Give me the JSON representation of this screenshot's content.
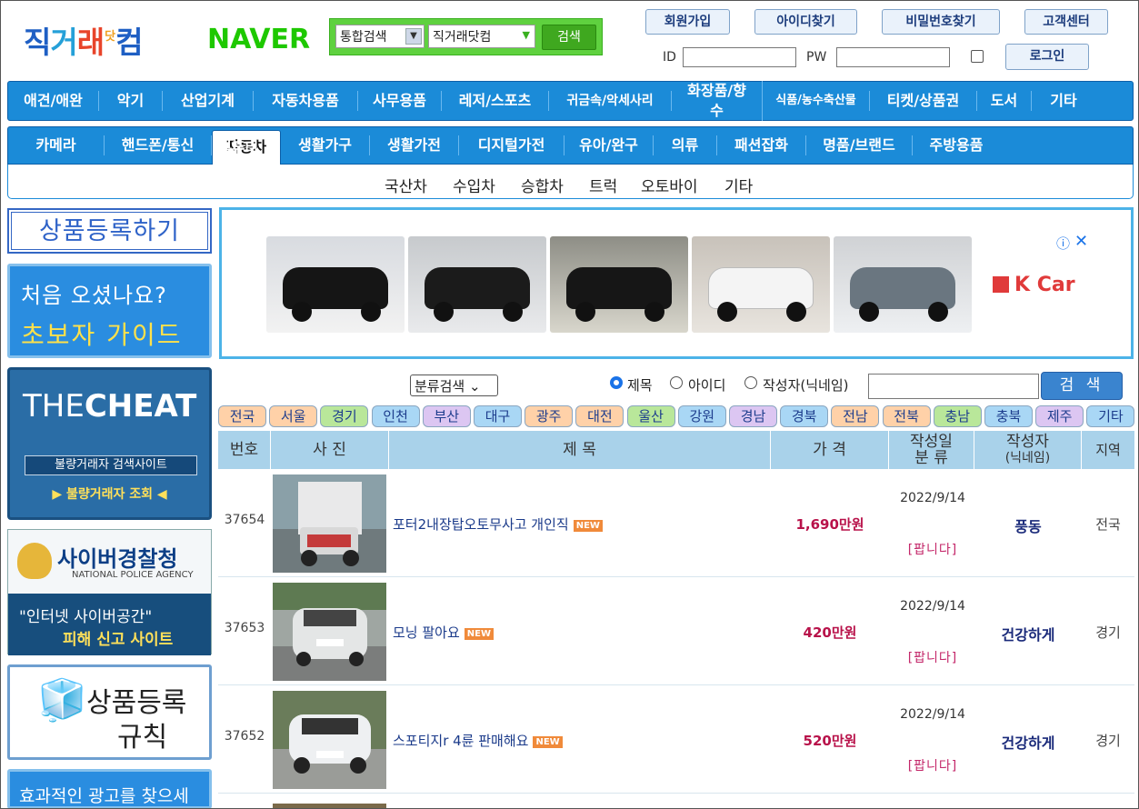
{
  "header": {
    "logo": {
      "part1": "직",
      "part2": "거",
      "part3": "래",
      "sup": "닷",
      "part4": "컴"
    },
    "naver": "NAVER",
    "search": {
      "scope": "통합검색",
      "site": "직거래닷컴",
      "button": "검색"
    },
    "top_buttons": [
      "회원가입",
      "아이디찾기",
      "비밀번호찾기",
      "고객센터"
    ],
    "login": {
      "id_label": "ID",
      "pw_label": "PW",
      "button": "로그인"
    }
  },
  "nav_main": [
    "애견/애완",
    "악기",
    "산업기계",
    "자동차용품",
    "사무용품",
    "레저/스포츠",
    "귀금속/악세사리",
    "화장품/향수",
    "식품/농수축산물",
    "티켓/상품권",
    "도서",
    "기타"
  ],
  "nav_sub": [
    "카메라",
    "핸드폰/통신",
    "컴퓨터",
    "자동차",
    "생활가구",
    "생활가전",
    "디지털가전",
    "유아/완구",
    "의류",
    "패션잡화",
    "명품/브랜드",
    "주방용품"
  ],
  "nav_sub_active": "자동차",
  "nav_sub2": [
    "국산차",
    "수입차",
    "승합차",
    "트럭",
    "오토바이",
    "기타"
  ],
  "left": {
    "register": "상품등록하기",
    "guide": {
      "line1": "처음 오셨나요?",
      "line2": "초보자 가이드"
    },
    "cheat": {
      "title_light": "THE",
      "title_bold": "CHEAT",
      "bar": "불량거래자 검색사이트",
      "link": "▶ 불량거래자 조회 ◀"
    },
    "police": {
      "title": "사이버경찰청",
      "sub": "NATIONAL POLICE AGENCY",
      "line1": "\"인터넷 사이버공간\"",
      "line2": "피해 신고 사이트"
    },
    "rules": {
      "line1": "상품등록",
      "line2": "규칙"
    },
    "ad": "효과적인 광고를 찾으세요?"
  },
  "banner": {
    "brand": "K Car",
    "info": "ⓘ",
    "close": "✕"
  },
  "search2": {
    "category": "분류검색",
    "radios": [
      "제목",
      "아이디",
      "작성자(닉네임)"
    ],
    "button": "검 색"
  },
  "regions": [
    "전국",
    "서울",
    "경기",
    "인천",
    "부산",
    "대구",
    "광주",
    "대전",
    "울산",
    "강원",
    "경남",
    "경북",
    "전남",
    "전북",
    "충남",
    "충북",
    "제주",
    "기타"
  ],
  "region_colors": [
    "#ffd1a8",
    "#ffd1a8",
    "#b9e79a",
    "#a9d7f5",
    "#dcc6f2",
    "#a9d7f5",
    "#ffd1a8",
    "#ffd1a8",
    "#b9e79a",
    "#a9d7f5",
    "#dcc6f2",
    "#a9d7f5",
    "#ffd1a8",
    "#ffd1a8",
    "#b9e79a",
    "#a9d7f5",
    "#dcc6f2",
    "#a9d7f5"
  ],
  "table": {
    "headers": {
      "no": "번호",
      "photo": "사 진",
      "title": "제 목",
      "price": "가 격",
      "date1": "작성일",
      "date2": "분 류",
      "author1": "작성자",
      "author2": "(닉네임)",
      "region": "지역"
    },
    "rows": [
      {
        "no": "37654",
        "title": "포터2내장탑오토무사고 개인직",
        "new": "NEW",
        "price": "1,690만원",
        "date": "2022/9/14",
        "type": "[팝니다]",
        "author": "풍동",
        "region": "전국"
      },
      {
        "no": "37653",
        "title": "모닝 팔아요",
        "new": "NEW",
        "price": "420만원",
        "date": "2022/9/14",
        "type": "[팝니다]",
        "author": "건강하게",
        "region": "경기"
      },
      {
        "no": "37652",
        "title": "스포티지r 4륜 판매해요",
        "new": "NEW",
        "price": "520만원",
        "date": "2022/9/14",
        "type": "[팝니다]",
        "author": "건강하게",
        "region": "경기"
      }
    ]
  }
}
